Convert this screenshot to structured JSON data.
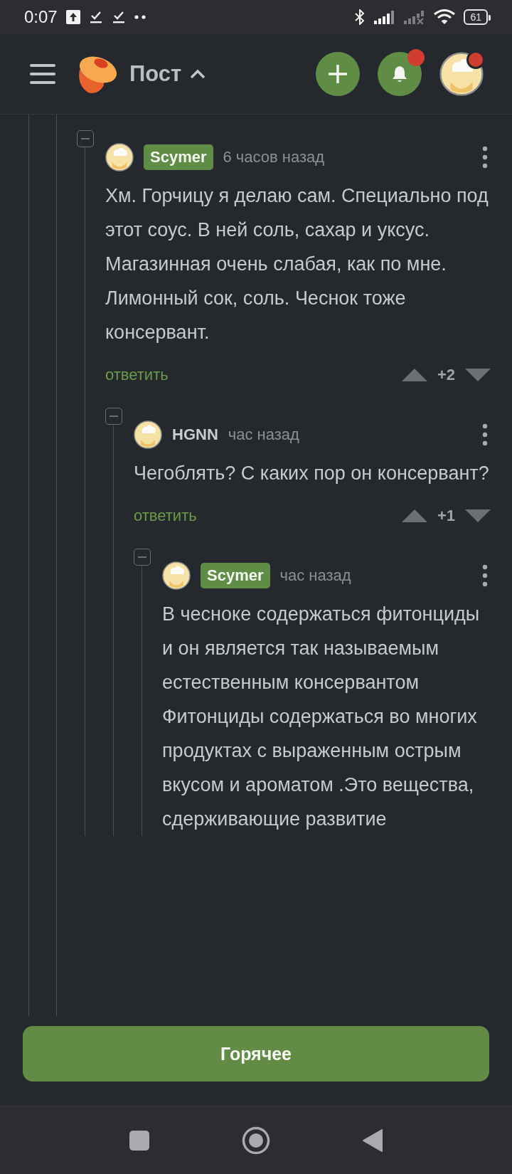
{
  "status_bar": {
    "time": "0:07",
    "battery": "61"
  },
  "header": {
    "title": "Пост",
    "notifications_badge": true,
    "profile_badge": true
  },
  "comments": [
    {
      "author": "Scymer",
      "author_highlighted": true,
      "time": "6 часов назад",
      "body": "Хм. Горчицу я делаю сам. Специально под этот соус. В ней соль, сахар и уксус. Магазинная очень слабая, как по мне. Лимонный сок, соль. Чеснок тоже консервант.",
      "reply_label": "ответить",
      "score": "+2",
      "children": [
        {
          "author": "HGNN",
          "author_highlighted": false,
          "time": "час назад",
          "body": "Чегоблять? С каких пор он консервант?",
          "reply_label": "ответить",
          "score": "+1",
          "children": [
            {
              "author": "Scymer",
              "author_highlighted": true,
              "time": "час назад",
              "body": "В чесноке содержаться фитонциды и он является так называемым естественным консервантом\nФитонциды содержаться во многих продуктах с выраженным острым вкусом и ароматом .Это вещества, сдерживающие развитие"
            }
          ]
        }
      ]
    }
  ],
  "hot_button": "Горячее"
}
